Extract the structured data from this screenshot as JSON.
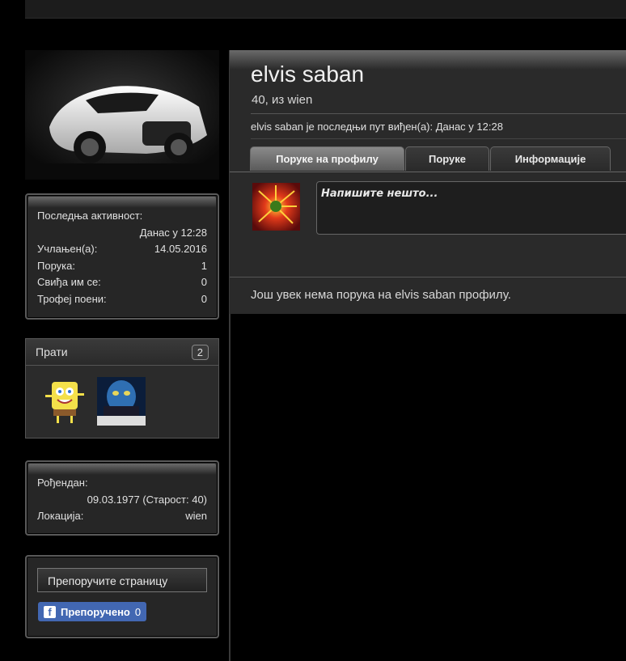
{
  "sidebar": {
    "stats": {
      "last_activity_label": "Последња активност:",
      "last_activity_value": "Данас у 12:28",
      "rows": [
        {
          "label": "Учлањен(а):",
          "value": "14.05.2016"
        },
        {
          "label": "Порука:",
          "value": "1"
        },
        {
          "label": "Свиђа им се:",
          "value": "0"
        },
        {
          "label": "Трофеј поени:",
          "value": "0"
        }
      ]
    },
    "following": {
      "label": "Прати",
      "count": "2"
    },
    "info": {
      "birthday_label": "Рођендан:",
      "birthday_value": "09.03.1977 (Старост: 40)",
      "location_label": "Локација:",
      "location_value": "wien"
    },
    "share": {
      "recommend_label": "Препоручите страницу",
      "fb_label": "Препоручено",
      "fb_count": "0"
    }
  },
  "profile": {
    "name": "elvis saban",
    "subline": "40, из wien",
    "last_seen": "elvis saban je последњи пут виђен(а): Данас у 12:28"
  },
  "tabs": [
    {
      "label": "Поруке на профилу"
    },
    {
      "label": "Поруке"
    },
    {
      "label": "Информације"
    }
  ],
  "post": {
    "placeholder": "Напишите нешто...",
    "empty_message": "Још увек нема порука на elvis saban профилу."
  },
  "colors": {
    "background": "#000000",
    "panel": "#262626",
    "active_tab": "#6e6e6e",
    "facebook": "#4267b2"
  }
}
